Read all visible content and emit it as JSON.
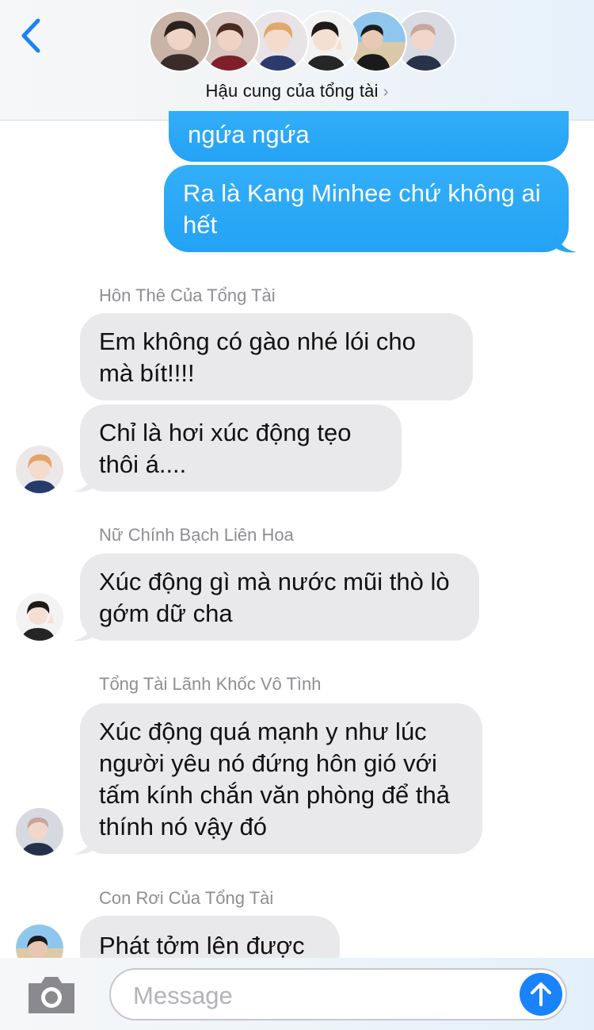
{
  "header": {
    "group_name": "Hậu cung của tổng tài",
    "chevron": "›",
    "back_icon": "chevron-left-icon",
    "member_avatars": 6
  },
  "messages": [
    {
      "direction": "outgoing",
      "text": "ngứa ngứa"
    },
    {
      "direction": "outgoing",
      "text": "Ra là Kang Minhee chứ không ai hết"
    },
    {
      "direction": "incoming",
      "sender": "Hôn Thê Của Tổng Tài",
      "texts": [
        "Em không có gào nhé lói cho mà bít!!!!",
        "Chỉ là hơi xúc động tẹo thôi á...."
      ]
    },
    {
      "direction": "incoming",
      "sender": "Nữ Chính Bạch Liên Hoa",
      "texts": [
        "Xúc động gì mà nước mũi thò lò gớm dữ cha"
      ]
    },
    {
      "direction": "incoming",
      "sender": "Tổng Tài Lãnh Khốc Vô Tình",
      "texts": [
        "Xúc động quá mạnh y như lúc người yêu nó đứng hôn gió với tấm kính chắn văn phòng để thả thính nó vậy đó"
      ]
    },
    {
      "direction": "incoming",
      "sender": "Con Rơi Của Tổng Tài",
      "texts": [
        "Phát tởm lên được"
      ]
    }
  ],
  "composer": {
    "placeholder": "Message",
    "camera_icon": "camera-icon",
    "send_icon": "arrow-up-icon"
  },
  "colors": {
    "outgoing_bubble": "#2aa6f6",
    "incoming_bubble": "#e9e9eb",
    "accent": "#1a82fb"
  }
}
